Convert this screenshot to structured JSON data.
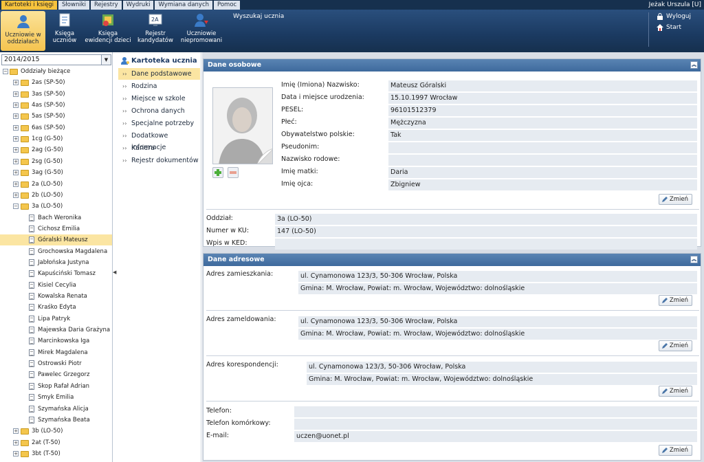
{
  "menu": {
    "tabs": [
      "Kartoteki i księgi",
      "Słowniki",
      "Rejestry",
      "Wydruki",
      "Wymiana danych",
      "Pomoc"
    ],
    "user": "Jeżak Urszula [U]"
  },
  "toolbar": {
    "buttons": [
      {
        "line1": "Uczniowie w",
        "line2": "oddziałach"
      },
      {
        "line1": "Księga",
        "line2": "uczniów"
      },
      {
        "line1": "Księga",
        "line2": "ewidencji dzieci"
      },
      {
        "line1": "Rejestr",
        "line2": "kandydatów"
      },
      {
        "line1": "Uczniowie",
        "line2": "niepromowani"
      }
    ],
    "search_label": "Wyszukaj ucznia",
    "logout": "Wyloguj",
    "start": "Start"
  },
  "tree": {
    "year": "2014/2015",
    "root": "Oddziały bieżące",
    "classes_before": [
      "2as (SP-50)",
      "3as (SP-50)",
      "4as (SP-50)",
      "5as (SP-50)",
      "6as (SP-50)",
      "1cg (G-50)",
      "2ag (G-50)",
      "2sg (G-50)",
      "3ag (G-50)",
      "2a (LO-50)",
      "2b (LO-50)"
    ],
    "open_class": "3a (LO-50)",
    "students": [
      "Bach Weronika",
      "Cichosz Emilia",
      "Góralski Mateusz",
      "Grochowska Magdalena",
      "Jabłońska Justyna",
      "Kapuściński Tomasz",
      "Kisiel Cecylia",
      "Kowalska Renata",
      "Kraśko Edyta",
      "Lipa Patryk",
      "Majewska Daria Grażyna",
      "Marcinkowska Iga",
      "Mirek Magdalena",
      "Ostrowski Piotr",
      "Pawelec Grzegorz",
      "Skop Rafał Adrian",
      "Smyk Emilia",
      "Szymańska Alicja",
      "Szymańska Beata"
    ],
    "selected_student": "Góralski Mateusz",
    "classes_after": [
      "3b (LO-50)",
      "2at (T-50)",
      "3bt (T-50)"
    ]
  },
  "nav": {
    "title": "Kartoteka ucznia",
    "items": [
      "Dane podstawowe",
      "Rodzina",
      "Miejsce w szkole",
      "Ochrona danych",
      "Specjalne potrzeby",
      "Dodatkowe informacje",
      "Kariera",
      "Rejestr dokumentów"
    ],
    "active": "Dane podstawowe"
  },
  "personal": {
    "header": "Dane osobowe",
    "fields": [
      {
        "label": "Imię (Imiona) Nazwisko:",
        "value": "Mateusz Góralski"
      },
      {
        "label": "Data i miejsce urodzenia:",
        "value": "15.10.1997 Wrocław"
      },
      {
        "label": "PESEL:",
        "value": "96101512379"
      },
      {
        "label": "Płeć:",
        "value": "Mężczyzna"
      },
      {
        "label": "Obywatelstwo polskie:",
        "value": "Tak"
      },
      {
        "label": "Pseudonim:",
        "value": ""
      },
      {
        "label": "Nazwisko rodowe:",
        "value": ""
      },
      {
        "label": "Imię matki:",
        "value": "Daria"
      },
      {
        "label": "Imię ojca:",
        "value": "Zbigniew"
      }
    ],
    "change": "Zmień",
    "class_fields": [
      {
        "label": "Oddział:",
        "value": "3a (LO-50)"
      },
      {
        "label": "Numer w KU:",
        "value": "147 (LO-50)"
      },
      {
        "label": "Wpis w KED:",
        "value": ""
      }
    ]
  },
  "address": {
    "header": "Dane adresowe",
    "blocks": [
      {
        "label": "Adres zamieszkania:",
        "line1": "ul. Cynamonowa 123/3, 50-306 Wrocław, Polska",
        "line2": "Gmina: M. Wrocław, Powiat: m. Wrocław, Województwo: dolnośląskie"
      },
      {
        "label": "Adres zameldowania:",
        "line1": "ul. Cynamonowa 123/3, 50-306 Wrocław, Polska",
        "line2": "Gmina: M. Wrocław, Powiat: m. Wrocław, Województwo: dolnośląskie"
      },
      {
        "label": "Adres korespondencji:",
        "line1": "ul. Cynamonowa 123/3, 50-306 Wrocław, Polska",
        "line2": "Gmina: M. Wrocław, Powiat: m. Wrocław, Województwo: dolnośląskie"
      }
    ],
    "contacts": [
      {
        "label": "Telefon:",
        "value": ""
      },
      {
        "label": "Telefon komórkowy:",
        "value": ""
      },
      {
        "label": "E-mail:",
        "value": "uczen@uonet.pl"
      }
    ],
    "change": "Zmień"
  },
  "colors": {
    "accent": "#f5c44f",
    "header": "#16304e",
    "panel_header": "#4a76a8"
  }
}
